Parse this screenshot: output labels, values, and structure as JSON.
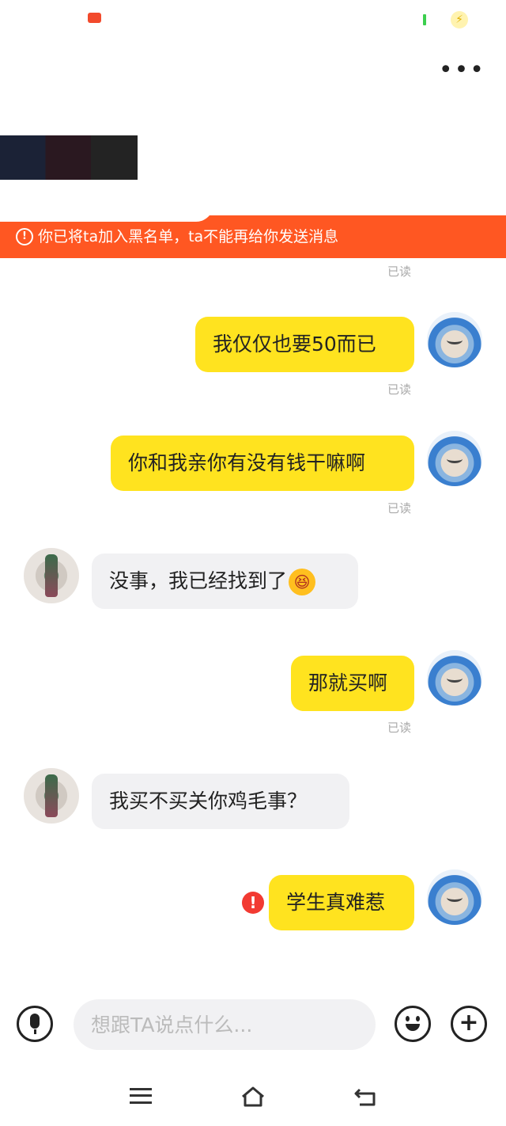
{
  "status_bar": {
    "app_icon": "notification-app-icon",
    "signal_icon": "signal-icon",
    "charging_icon": "charging-icon"
  },
  "header": {
    "more_icon": "more-dots-icon",
    "more_label": "•••"
  },
  "banner": {
    "icon": "info-circle-icon",
    "icon_glyph": "!",
    "text": "你已将ta加入黑名单，ta不能再给你发送消息",
    "color": "#ff5722"
  },
  "messages": [
    {
      "side": "mine",
      "text": "我仅仅也要50而已",
      "status": "已读"
    },
    {
      "side": "mine",
      "text": "你和我亲你有没有钱干嘛啊",
      "status": "已读"
    },
    {
      "side": "theirs",
      "text": "没事，我已经找到了",
      "emoji": "😆"
    },
    {
      "side": "mine",
      "text": "那就买啊",
      "status": "已读"
    },
    {
      "side": "theirs",
      "text": "我买不买关你鸡毛事？"
    },
    {
      "side": "mine",
      "text": "学生真难惹",
      "failed": true,
      "error_glyph": "!"
    }
  ],
  "read_receipt_top": "已读",
  "input": {
    "placeholder": "想跟TA说点什么...",
    "value": ""
  },
  "toolbar": {
    "plus_label": "+"
  },
  "colors": {
    "my_bubble": "#ffe31f",
    "their_bubble": "#f1f1f3",
    "error": "#f23a32",
    "receipt": "#aaaaaa"
  }
}
